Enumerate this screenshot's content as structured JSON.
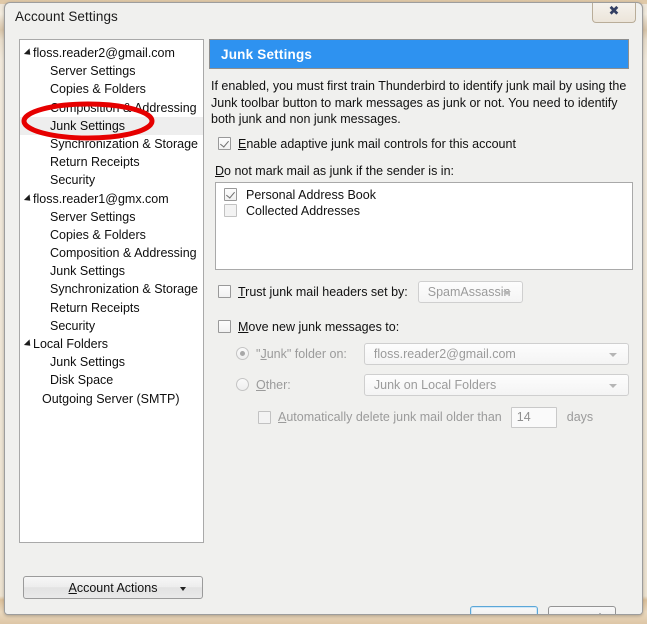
{
  "window": {
    "title": "Account Settings",
    "close_label": "✕"
  },
  "sidebar": {
    "items": [
      {
        "label": "floss.reader2@gmail.com",
        "level": "account",
        "twisty": true,
        "selected": false
      },
      {
        "label": "Server Settings",
        "level": "child",
        "twisty": false,
        "selected": false
      },
      {
        "label": "Copies & Folders",
        "level": "child",
        "twisty": false,
        "selected": false
      },
      {
        "label": "Composition & Addressing",
        "level": "child",
        "twisty": false,
        "selected": false
      },
      {
        "label": "Junk Settings",
        "level": "child",
        "twisty": false,
        "selected": true
      },
      {
        "label": "Synchronization & Storage",
        "level": "child",
        "twisty": false,
        "selected": false
      },
      {
        "label": "Return Receipts",
        "level": "child",
        "twisty": false,
        "selected": false
      },
      {
        "label": "Security",
        "level": "child",
        "twisty": false,
        "selected": false
      },
      {
        "label": "floss.reader1@gmx.com",
        "level": "account",
        "twisty": true,
        "selected": false
      },
      {
        "label": "Server Settings",
        "level": "child",
        "twisty": false,
        "selected": false
      },
      {
        "label": "Copies & Folders",
        "level": "child",
        "twisty": false,
        "selected": false
      },
      {
        "label": "Composition & Addressing",
        "level": "child",
        "twisty": false,
        "selected": false
      },
      {
        "label": "Junk Settings",
        "level": "child",
        "twisty": false,
        "selected": false
      },
      {
        "label": "Synchronization & Storage",
        "level": "child",
        "twisty": false,
        "selected": false
      },
      {
        "label": "Return Receipts",
        "level": "child",
        "twisty": false,
        "selected": false
      },
      {
        "label": "Security",
        "level": "child",
        "twisty": false,
        "selected": false
      },
      {
        "label": "Local Folders",
        "level": "account",
        "twisty": true,
        "selected": false
      },
      {
        "label": "Junk Settings",
        "level": "child",
        "twisty": false,
        "selected": false
      },
      {
        "label": "Disk Space",
        "level": "child",
        "twisty": false,
        "selected": false
      },
      {
        "label": "Outgoing Server (SMTP)",
        "level": "smtp",
        "twisty": false,
        "selected": false
      }
    ],
    "account_actions": {
      "label_accesskey": "A",
      "label_rest": "ccount Actions"
    }
  },
  "pane": {
    "header": "Junk Settings",
    "description": "If enabled, you must first train Thunderbird to identify junk mail by using the Junk toolbar button to mark messages as junk or not. You need to identify both junk and non junk messages.",
    "enable_adaptive": {
      "accesskey": "E",
      "label_rest": "nable adaptive junk mail controls for this account",
      "checked": true
    },
    "sender_label": {
      "accesskey": "D",
      "label_rest": "o not mark mail as junk if the sender is in:"
    },
    "address_books": [
      {
        "label": "Personal Address Book",
        "checked": true
      },
      {
        "label": "Collected Addresses",
        "checked": false
      }
    ],
    "trust_headers": {
      "accesskey": "T",
      "label_rest": "rust junk mail headers set by:",
      "checked": false,
      "value": "SpamAssassin",
      "disabled": true
    },
    "move_junk": {
      "accesskey": "M",
      "label_rest": "ove new junk messages to:",
      "checked": false
    },
    "junk_folder_radio": {
      "label_pre": "\"",
      "accesskey": "J",
      "label_rest": "unk\" folder on:",
      "selected": true,
      "value": "floss.reader2@gmail.com"
    },
    "other_radio": {
      "accesskey": "O",
      "label_rest": "ther:",
      "selected": false,
      "value": "Junk on Local Folders"
    },
    "auto_delete": {
      "accesskey": "A",
      "label_rest": "utomatically delete junk mail older than",
      "checked": false,
      "days_value": "14",
      "days_unit": "days"
    }
  },
  "footer": {
    "ok": "OK",
    "cancel": "Cancel"
  },
  "annotation": {
    "shape": "red-ellipse",
    "target": "Junk Settings",
    "color": "#e60000"
  },
  "colors": {
    "header_blue": "#2e92f0",
    "annotation_red": "#e60000",
    "focus_blue": "#5ba7d8",
    "dialog_bg": "#f0f0ee",
    "backdrop": "#e6d8be"
  }
}
